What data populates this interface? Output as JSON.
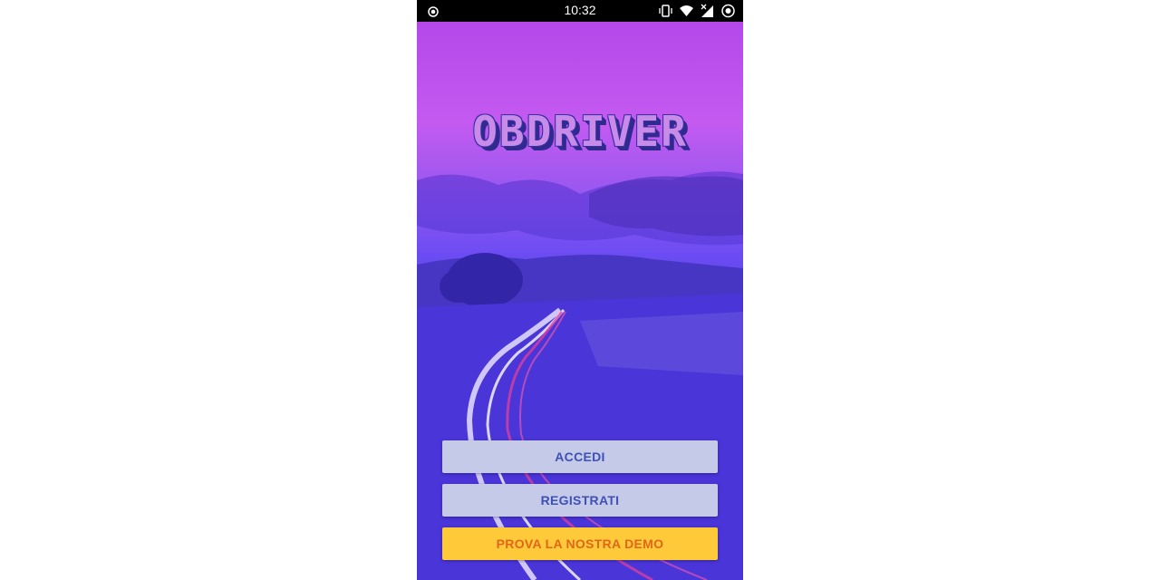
{
  "status_bar": {
    "time": "10:32",
    "left_icon": "record-icon",
    "right_icons": [
      "vibrate-icon",
      "wifi-icon",
      "signal-icon",
      "battery-saver-icon"
    ]
  },
  "app": {
    "logo_text": "OBDRIVER",
    "background": "purple sunset road with light trails"
  },
  "buttons": {
    "login_label": "ACCEDI",
    "register_label": "REGISTRATI",
    "demo_label": "PROVA LA NOSTRA DEMO"
  },
  "colors": {
    "button_light_bg": "#c5cae9",
    "button_light_text": "#3f51b5",
    "button_accent_bg": "#ffca3a",
    "button_accent_text": "#e0661a"
  }
}
